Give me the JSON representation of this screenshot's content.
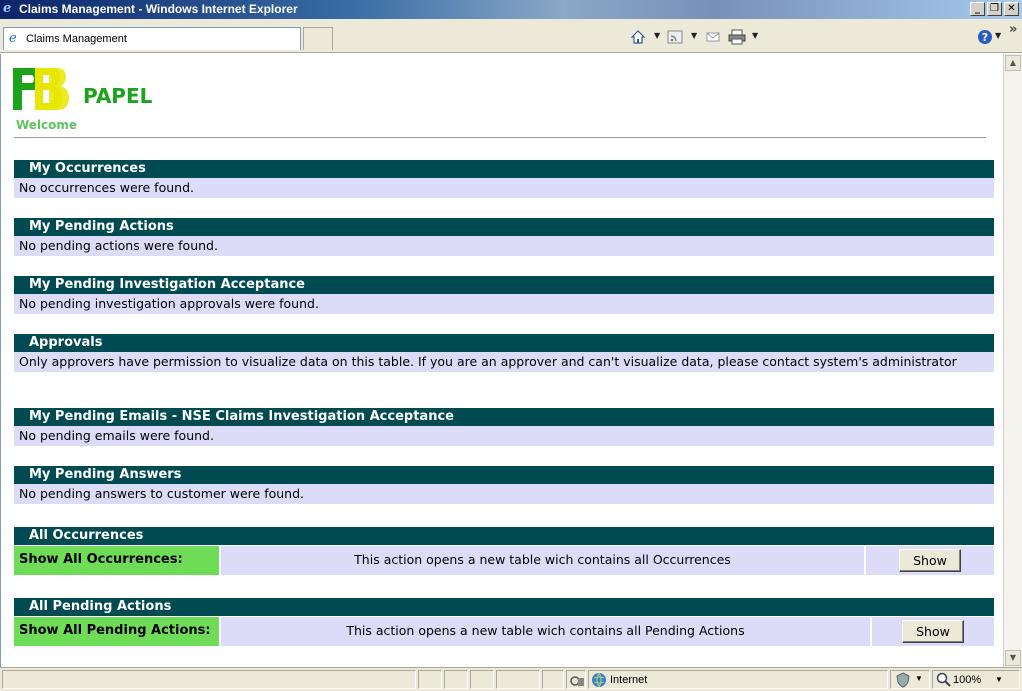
{
  "window": {
    "title": "Claims Management - Windows Internet Explorer",
    "minimize": "_",
    "restore": "❐",
    "close": "✕"
  },
  "toolbar": {
    "tab_label": "Claims Management",
    "chevron": "»"
  },
  "page": {
    "brand": "PAPEL",
    "welcome": "Welcome"
  },
  "sections": [
    {
      "title": "My Occurrences",
      "message": "No occurrences were found."
    },
    {
      "title": "My Pending Actions",
      "message": "No pending actions were found."
    },
    {
      "title": "My Pending Investigation Acceptance",
      "message": "No pending investigation approvals were found."
    },
    {
      "title": "Approvals",
      "message": "Only approvers have permission to visualize data on this table. If you are an approver and can't visualize data, please contact system's administrator"
    },
    {
      "title": "My Pending Emails - NSE Claims Investigation Acceptance",
      "message": "No pending emails were found."
    },
    {
      "title": "My Pending Answers",
      "message": "No pending answers to customer were found."
    }
  ],
  "action_sections": [
    {
      "title": "All Occurrences",
      "label": "Show All Occurrences:",
      "description": "This action opens a new table wich contains all Occurrences",
      "button": "Show"
    },
    {
      "title": "All Pending Actions",
      "label": "Show All Pending Actions:",
      "description": "This action opens a new table wich contains all Pending Actions",
      "button": "Show"
    }
  ],
  "statusbar": {
    "zone": "Internet",
    "zoom": "100%"
  },
  "colors": {
    "section_header": "#004b52",
    "section_body": "#dcdcf8",
    "label_green": "#6edc56",
    "brand_green": "#1ca31c"
  }
}
